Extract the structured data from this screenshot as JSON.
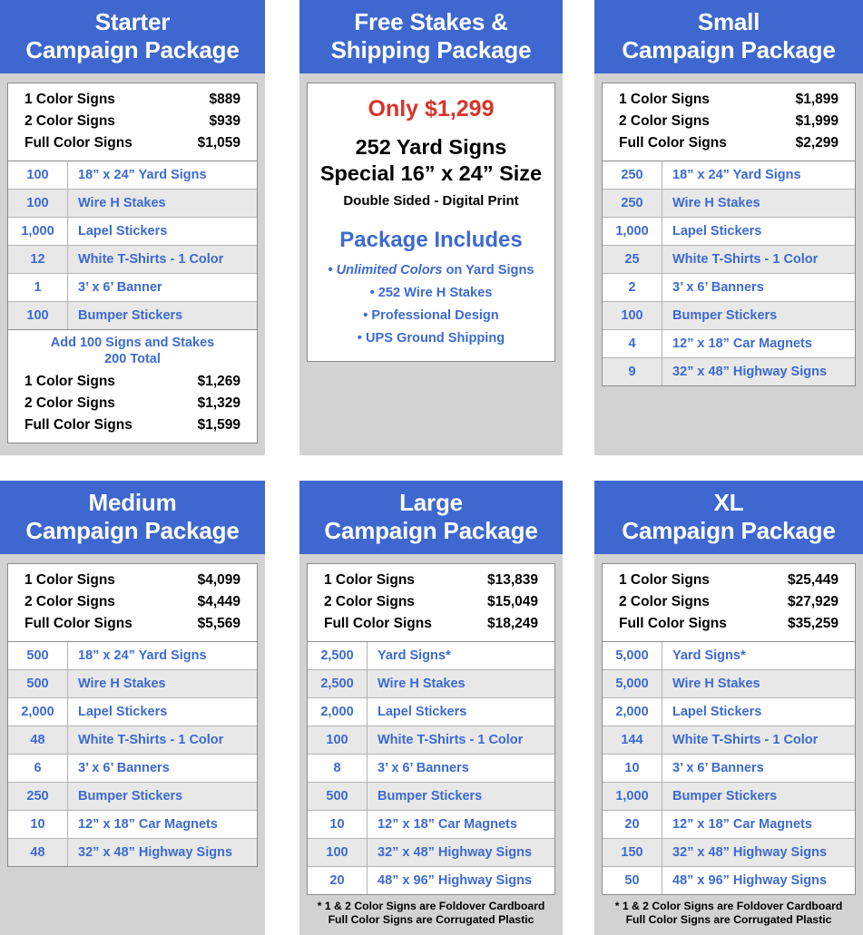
{
  "packages": [
    {
      "id": "starter",
      "title_line1": "Starter",
      "title_line2": "Campaign Package",
      "prices": [
        {
          "label": "1 Color Signs",
          "value": "$889"
        },
        {
          "label": "2 Color Signs",
          "value": "$939"
        },
        {
          "label": "Full Color Signs",
          "value": "$1,059"
        }
      ],
      "items": [
        {
          "qty": "100",
          "label": "18” x 24” Yard Signs"
        },
        {
          "qty": "100",
          "label": "Wire H Stakes"
        },
        {
          "qty": "1,000",
          "label": "Lapel Stickers"
        },
        {
          "qty": "12",
          "label": "White T-Shirts - 1 Color"
        },
        {
          "qty": "1",
          "label": "3’ x 6’ Banner"
        },
        {
          "qty": "100",
          "label": "Bumper Stickers"
        }
      ],
      "addon": {
        "title_line1": "Add 100 Signs and Stakes",
        "title_line2": "200 Total",
        "prices": [
          {
            "label": "1 Color Signs",
            "value": "$1,269"
          },
          {
            "label": "2 Color Signs",
            "value": "$1,329"
          },
          {
            "label": "Full Color Signs",
            "value": "$1,599"
          }
        ]
      },
      "footnote": null
    },
    {
      "id": "free-stakes-shipping",
      "title_line1": "Free Stakes &",
      "title_line2": "Shipping Package",
      "feature": {
        "price": "Only $1,299",
        "headline_line1": "252 Yard Signs",
        "headline_line2": "Special 16” x 24” Size",
        "subline": "Double Sided - Digital Print",
        "includes_title": "Package Includes",
        "bullets": [
          {
            "bullet": "•",
            "emphasis": "Unlimited Colors",
            "rest": " on Yard Signs"
          },
          {
            "bullet": "•",
            "emphasis": "",
            "rest": "252 Wire H Stakes"
          },
          {
            "bullet": "•",
            "emphasis": "",
            "rest": "Professional Design"
          },
          {
            "bullet": "•",
            "emphasis": "",
            "rest": "UPS Ground Shipping"
          }
        ]
      }
    },
    {
      "id": "small",
      "title_line1": "Small",
      "title_line2": "Campaign Package",
      "prices": [
        {
          "label": "1 Color Signs",
          "value": "$1,899"
        },
        {
          "label": "2 Color Signs",
          "value": "$1,999"
        },
        {
          "label": "Full Color Signs",
          "value": "$2,299"
        }
      ],
      "items": [
        {
          "qty": "250",
          "label": "18” x 24” Yard Signs"
        },
        {
          "qty": "250",
          "label": "Wire H Stakes"
        },
        {
          "qty": "1,000",
          "label": "Lapel Stickers"
        },
        {
          "qty": "25",
          "label": "White T-Shirts - 1 Color"
        },
        {
          "qty": "2",
          "label": "3’ x 6’ Banners"
        },
        {
          "qty": "100",
          "label": "Bumper Stickers"
        },
        {
          "qty": "4",
          "label": "12” x 18” Car Magnets"
        },
        {
          "qty": "9",
          "label": "32” x 48” Highway Signs"
        }
      ],
      "addon": null,
      "footnote": null
    },
    {
      "id": "medium",
      "title_line1": "Medium",
      "title_line2": "Campaign Package",
      "prices": [
        {
          "label": "1 Color Signs",
          "value": "$4,099"
        },
        {
          "label": "2 Color Signs",
          "value": "$4,449"
        },
        {
          "label": "Full Color Signs",
          "value": "$5,569"
        }
      ],
      "items": [
        {
          "qty": "500",
          "label": "18” x 24” Yard Signs"
        },
        {
          "qty": "500",
          "label": "Wire H Stakes"
        },
        {
          "qty": "2,000",
          "label": "Lapel Stickers"
        },
        {
          "qty": "48",
          "label": "White T-Shirts - 1 Color"
        },
        {
          "qty": "6",
          "label": "3’ x 6’ Banners"
        },
        {
          "qty": "250",
          "label": "Bumper Stickers"
        },
        {
          "qty": "10",
          "label": "12” x 18” Car Magnets"
        },
        {
          "qty": "48",
          "label": "32” x 48” Highway Signs"
        }
      ],
      "addon": null,
      "footnote": null
    },
    {
      "id": "large",
      "title_line1": "Large",
      "title_line2": "Campaign Package",
      "prices": [
        {
          "label": "1 Color Signs",
          "value": "$13,839"
        },
        {
          "label": "2 Color Signs",
          "value": "$15,049"
        },
        {
          "label": "Full Color Signs",
          "value": "$18,249"
        }
      ],
      "items": [
        {
          "qty": "2,500",
          "label": "Yard Signs*"
        },
        {
          "qty": "2,500",
          "label": "Wire H Stakes"
        },
        {
          "qty": "2,000",
          "label": "Lapel Stickers"
        },
        {
          "qty": "100",
          "label": "White T-Shirts - 1 Color"
        },
        {
          "qty": "8",
          "label": "3’ x 6’ Banners"
        },
        {
          "qty": "500",
          "label": "Bumper Stickers"
        },
        {
          "qty": "10",
          "label": "12” x 18” Car Magnets"
        },
        {
          "qty": "100",
          "label": "32” x 48” Highway Signs"
        },
        {
          "qty": "20",
          "label": "48” x 96” Highway Signs"
        }
      ],
      "addon": null,
      "footnote": {
        "line1": "* 1 & 2 Color Signs are Foldover Cardboard",
        "line2": "Full Color Signs are Corrugated Plastic"
      }
    },
    {
      "id": "xl",
      "title_line1": "XL",
      "title_line2": "Campaign Package",
      "prices": [
        {
          "label": "1 Color Signs",
          "value": "$25,449"
        },
        {
          "label": "2 Color Signs",
          "value": "$27,929"
        },
        {
          "label": "Full Color Signs",
          "value": "$35,259"
        }
      ],
      "items": [
        {
          "qty": "5,000",
          "label": "Yard Signs*"
        },
        {
          "qty": "5,000",
          "label": "Wire H Stakes"
        },
        {
          "qty": "2,000",
          "label": "Lapel Stickers"
        },
        {
          "qty": "144",
          "label": "White T-Shirts - 1 Color"
        },
        {
          "qty": "10",
          "label": "3’ x 6’ Banners"
        },
        {
          "qty": "1,000",
          "label": "Bumper Stickers"
        },
        {
          "qty": "20",
          "label": "12” x 18” Car Magnets"
        },
        {
          "qty": "150",
          "label": "32” x 48” Highway Signs"
        },
        {
          "qty": "50",
          "label": "48” x 96” Highway Signs"
        }
      ],
      "addon": null,
      "footnote": {
        "line1": "* 1 & 2 Color Signs are Foldover Cardboard",
        "line2": "Full Color Signs are Corrugated Plastic"
      }
    }
  ],
  "colors": {
    "header_blue": "#3e68cf",
    "accent_blue": "#3d6ad2",
    "price_red": "#d8342a",
    "card_bg": "#d2d2d2",
    "row_shade": "#e8e8e8",
    "text_black": "#000000"
  }
}
